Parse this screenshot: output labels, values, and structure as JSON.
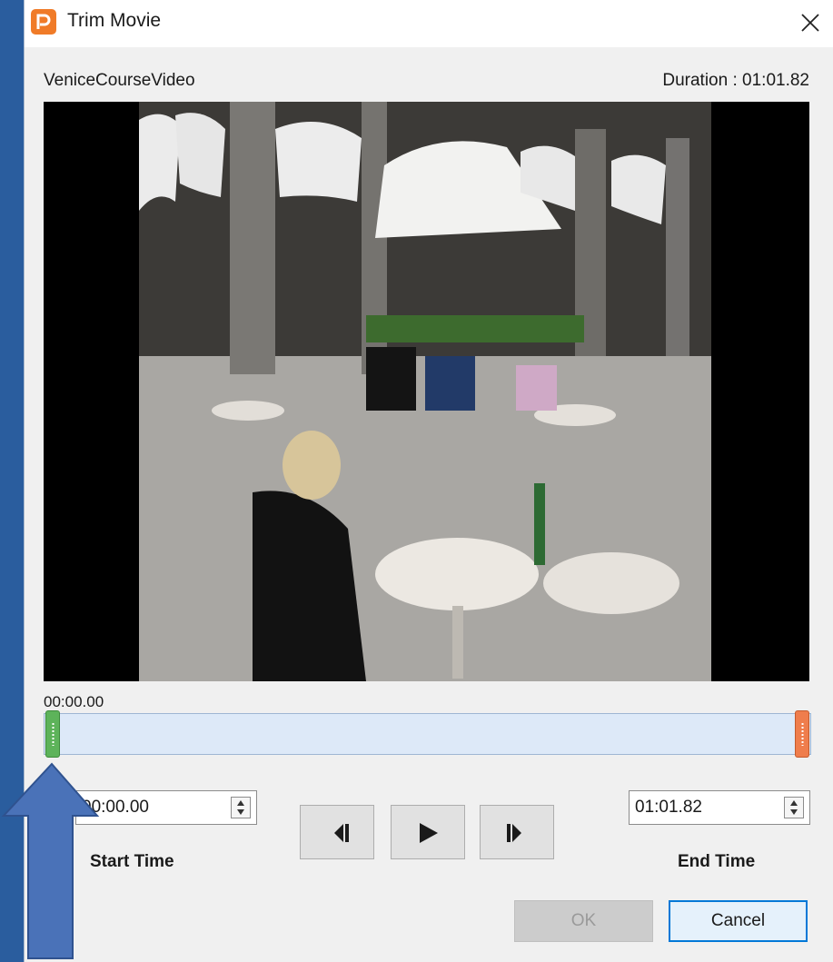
{
  "window": {
    "title": "Trim Movie",
    "app_icon": "powerpoint-icon",
    "close_icon": "close-icon"
  },
  "video": {
    "name": "VeniceCourseVideo",
    "duration": "Duration : 01:01.82"
  },
  "timeline": {
    "current_time": "00:00.00"
  },
  "start_time": {
    "value": "00:00.00",
    "visible_text": "00",
    "label": "Start Time"
  },
  "end_time": {
    "value": "01:01.82",
    "label": "End Time"
  },
  "playback": {
    "previous_frame_icon": "previous-frame-icon",
    "play_icon": "play-icon",
    "next_frame_icon": "next-frame-icon"
  },
  "buttons": {
    "ok": "OK",
    "cancel": "Cancel"
  },
  "annotation": {
    "icon": "up-arrow-icon",
    "color": "#4a72b8"
  },
  "colors": {
    "accent": "#0078d7",
    "start_handle": "#5db35a",
    "end_handle": "#ef7d4c",
    "track": "#dde9f8"
  }
}
